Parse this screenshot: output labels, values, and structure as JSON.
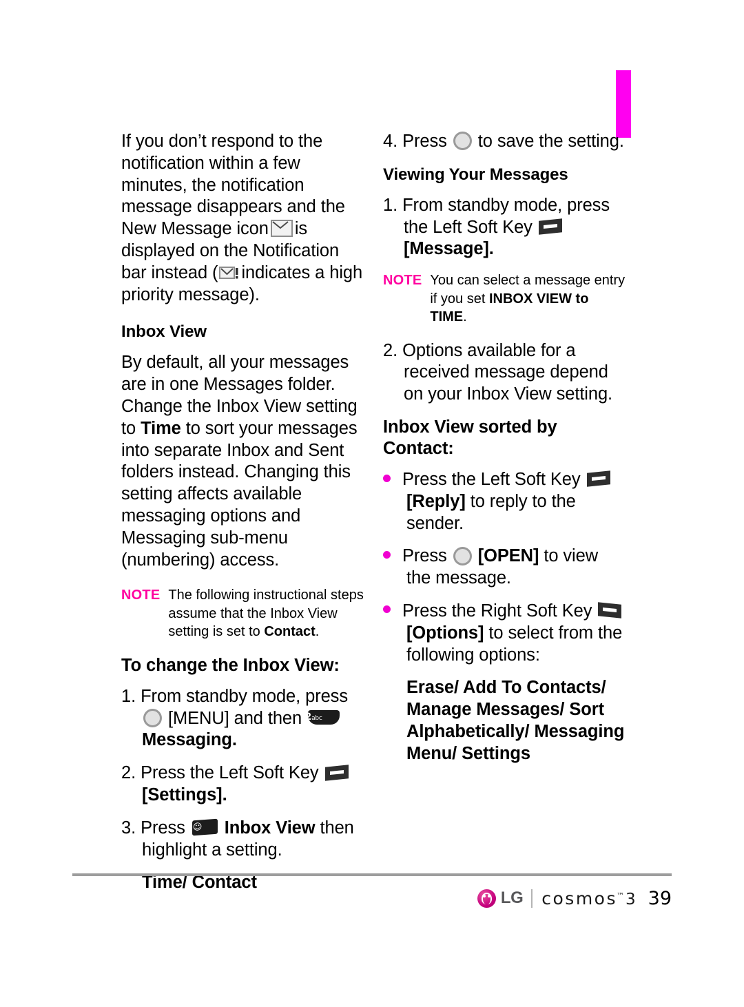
{
  "page": {
    "number": "39",
    "tab_color": "#ff00f0",
    "note_label_color": "#ff00a0",
    "bullet_color": "#f000d0"
  },
  "left_column": {
    "intro_paragraph": {
      "part1": "If you don’t respond to the notification within a few minutes, the notification message disappears and the New Message icon",
      "part2": "is displayed on the Notification bar instead (",
      "part3": "indicates a high priority message)."
    },
    "inbox_view_heading": "Inbox View",
    "inbox_view_paragraph": {
      "part1": "By default, all your messages are in one Messages folder. Change the Inbox View setting to",
      "emphasis": "Time",
      "part2": "to sort your messages into separate Inbox and Sent folders instead. Changing this setting affects available messaging options and Messaging sub-menu (numbering) access."
    },
    "note": {
      "label": "NOTE",
      "part1": "The following instructional steps assume that the Inbox View setting is set to",
      "emphasis": "Contact",
      "part2": "."
    },
    "to_change_heading": "To change the Inbox View:",
    "steps": {
      "step1": {
        "num": "1.",
        "part1": "From standby mode, press",
        "part2": "[MENU] and then",
        "part3": "Messaging."
      },
      "step2": {
        "num": "2.",
        "part1": "Press the Left Soft Key",
        "part2": "[Settings]."
      },
      "step3": {
        "num": "3.",
        "part1": "Press",
        "part2": "Inbox View",
        "part3": "then highlight a setting."
      },
      "step3_options": "Time/ Contact"
    }
  },
  "right_column": {
    "step4": {
      "num": "4.",
      "part1": "Press",
      "part2": "to save the setting."
    },
    "viewing_heading": "Viewing Your Messages",
    "step1": {
      "num": "1.",
      "part1": "From standby mode, press the Left Soft Key",
      "part2": "[Message]."
    },
    "note": {
      "label": "NOTE",
      "part1": "You can select a message entry if you set",
      "emphasis": "INBOX VIEW to TIME",
      "part2": "."
    },
    "step2": {
      "num": "2.",
      "text": "Options available for a received message depend on your Inbox View setting."
    },
    "sorted_heading": "Inbox View sorted by Contact:",
    "bullets": {
      "bullet1": {
        "part1": "Press the Left Soft Key",
        "emphasis": "[Reply]",
        "part2": "to reply to the sender."
      },
      "bullet2": {
        "part1": "Press",
        "emphasis": "[OPEN]",
        "part2": "to view the message."
      },
      "bullet3": {
        "part1": "Press the Right Soft Key",
        "emphasis": "[Options]",
        "part2": "to select from the following options:"
      }
    },
    "options_list": "Erase/ Add To Contacts/ Manage Messages/ Sort Alphabetically/ Messaging Menu/ Settings"
  },
  "footer": {
    "brand": "LG",
    "product": "cosmos",
    "tm": "™",
    "generation": "3",
    "page_number": "39"
  }
}
